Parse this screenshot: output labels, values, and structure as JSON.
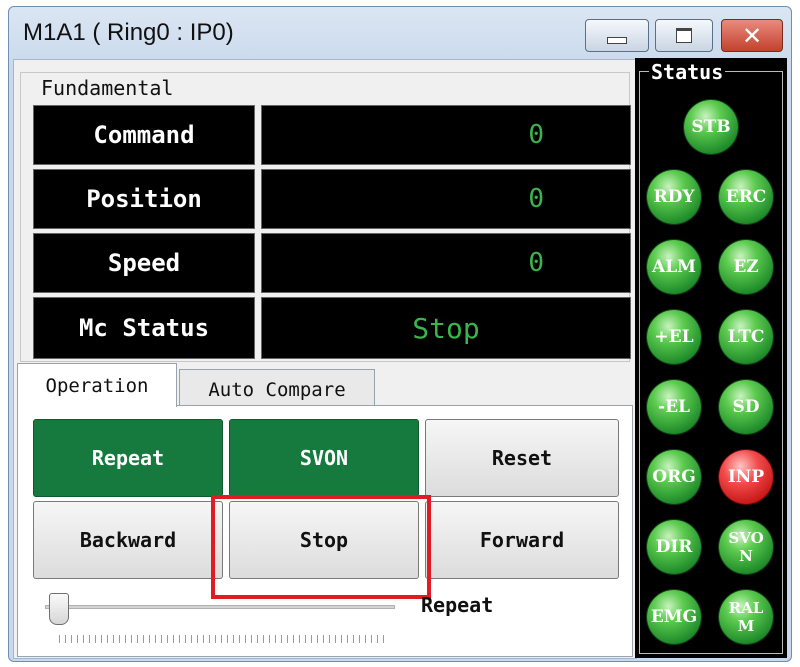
{
  "window": {
    "title": "M1A1 ( Ring0 : IP0)",
    "close_glyph": "✕"
  },
  "fundamental": {
    "legend": "Fundamental",
    "rows": [
      {
        "label": "Command",
        "value": "0"
      },
      {
        "label": "Position",
        "value": "0"
      },
      {
        "label": "Speed",
        "value": "0"
      },
      {
        "label": "Mc Status",
        "value": "Stop"
      }
    ]
  },
  "tabs": [
    {
      "label": "Operation",
      "active": true
    },
    {
      "label": "Auto Compare",
      "active": false
    }
  ],
  "operation": {
    "buttons": [
      {
        "label": "Repeat",
        "style": "green"
      },
      {
        "label": "SVON",
        "style": "green"
      },
      {
        "label": "Reset",
        "style": "gray"
      },
      {
        "label": "Backward",
        "style": "gray"
      },
      {
        "label": "Stop",
        "style": "gray"
      },
      {
        "label": "Forward",
        "style": "gray"
      }
    ],
    "repeat_label": "Repeat"
  },
  "status": {
    "title": "Status",
    "leds": [
      {
        "label": "STB",
        "color": "green"
      },
      {
        "label": "RDY",
        "color": "green"
      },
      {
        "label": "ERC",
        "color": "green"
      },
      {
        "label": "ALM",
        "color": "green"
      },
      {
        "label": "EZ",
        "color": "green"
      },
      {
        "label": "+EL",
        "color": "green"
      },
      {
        "label": "LTC",
        "color": "green"
      },
      {
        "label": "-EL",
        "color": "green"
      },
      {
        "label": "SD",
        "color": "green"
      },
      {
        "label": "ORG",
        "color": "green"
      },
      {
        "label": "INP",
        "color": "red"
      },
      {
        "label": "DIR",
        "color": "green"
      },
      {
        "label": "SVO N",
        "color": "green"
      },
      {
        "label": "EMG",
        "color": "green"
      },
      {
        "label": "RAL M",
        "color": "green"
      }
    ]
  },
  "colors": {
    "value_green": "#39b54a",
    "button_green": "#167a3e",
    "led_red": "#e01b24",
    "highlight": "#e01b24"
  }
}
